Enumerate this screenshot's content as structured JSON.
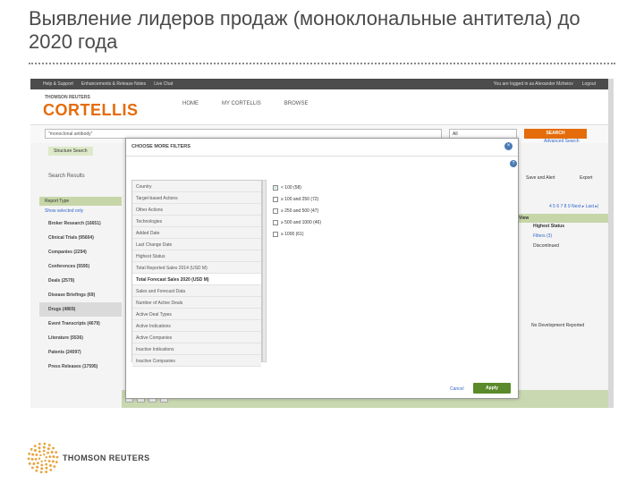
{
  "slide": {
    "title": "Выявление лидеров продаж (моноклональные антитела) до 2020 года"
  },
  "app": {
    "topbar": {
      "links": [
        "Help & Support",
        "Enhancements & Release Notes",
        "Live Chat"
      ],
      "logged_in": "You are logged in as Alexander Mzheiov",
      "logout": "Logout"
    },
    "brand_small": "THOMSON REUTERS",
    "brand_big": "CORTELLIS",
    "nav": [
      "HOME",
      "MY CORTELLIS",
      "BROWSE"
    ],
    "search": {
      "query": "\"monoclonal antibody\"",
      "scope": "All",
      "button": "SEARCH",
      "advanced": "Advanced Search",
      "structure": "Structure Search"
    },
    "left": {
      "search_results": "Search Results",
      "report_type": "Report Type",
      "show_selected": "Show selected only",
      "categories": [
        "Broker Research (16651)",
        "Clinical Trials (95604)",
        "Companies (2294)",
        "Conferences (5595)",
        "Deals (2579)",
        "Disease Briefings (69)",
        "Drugs (4869)",
        "Event Transcripts (4679)",
        "Literature (5536)",
        "Patents (24097)",
        "Press Releases (17595)"
      ],
      "selected_index": 6
    },
    "right": {
      "save_alert": "Save and Alert",
      "export": "Export",
      "pagination": "4 5 6 7 8 9 Next ▸ Last ▸|",
      "view": "View",
      "highest_status": "Highest Status",
      "filter_link": "Filters (3)",
      "discontinued": "Discontinued",
      "no_dev": "No Development Reported"
    },
    "modal": {
      "title": "CHOOSE MORE FILTERS",
      "filters": [
        "Country",
        "Target-based Actions",
        "Other Actions",
        "Technologies",
        "Added Date",
        "Last Change Date",
        "Highest Status",
        "Total Reported Sales 2014 (USD M)",
        "Total Forecast Sales 2020 (USD M)",
        "Sales and Forecast Data",
        "Number of Active Deals",
        "Active Deal Types",
        "Active Indications",
        "Active Companies",
        "Inactive Indications",
        "Inactive Companies"
      ],
      "selected_filter": 8,
      "options": [
        {
          "label": "< 100 (58)",
          "checked": true
        },
        {
          "label": "≥ 100 and 250 (72)",
          "checked": false
        },
        {
          "label": "≥ 250 and 500 (47)",
          "checked": false
        },
        {
          "label": "≥ 500 and 1000 (46)",
          "checked": false
        },
        {
          "label": "≥ 1000 (61)",
          "checked": false
        }
      ],
      "cancel": "Cancel",
      "apply": "Apply"
    }
  },
  "footer": {
    "company": "THOMSON REUTERS"
  },
  "colors": {
    "brand_orange": "#e46c0a",
    "apply_green": "#5b8a2a",
    "band_green": "#c9d8b0"
  }
}
